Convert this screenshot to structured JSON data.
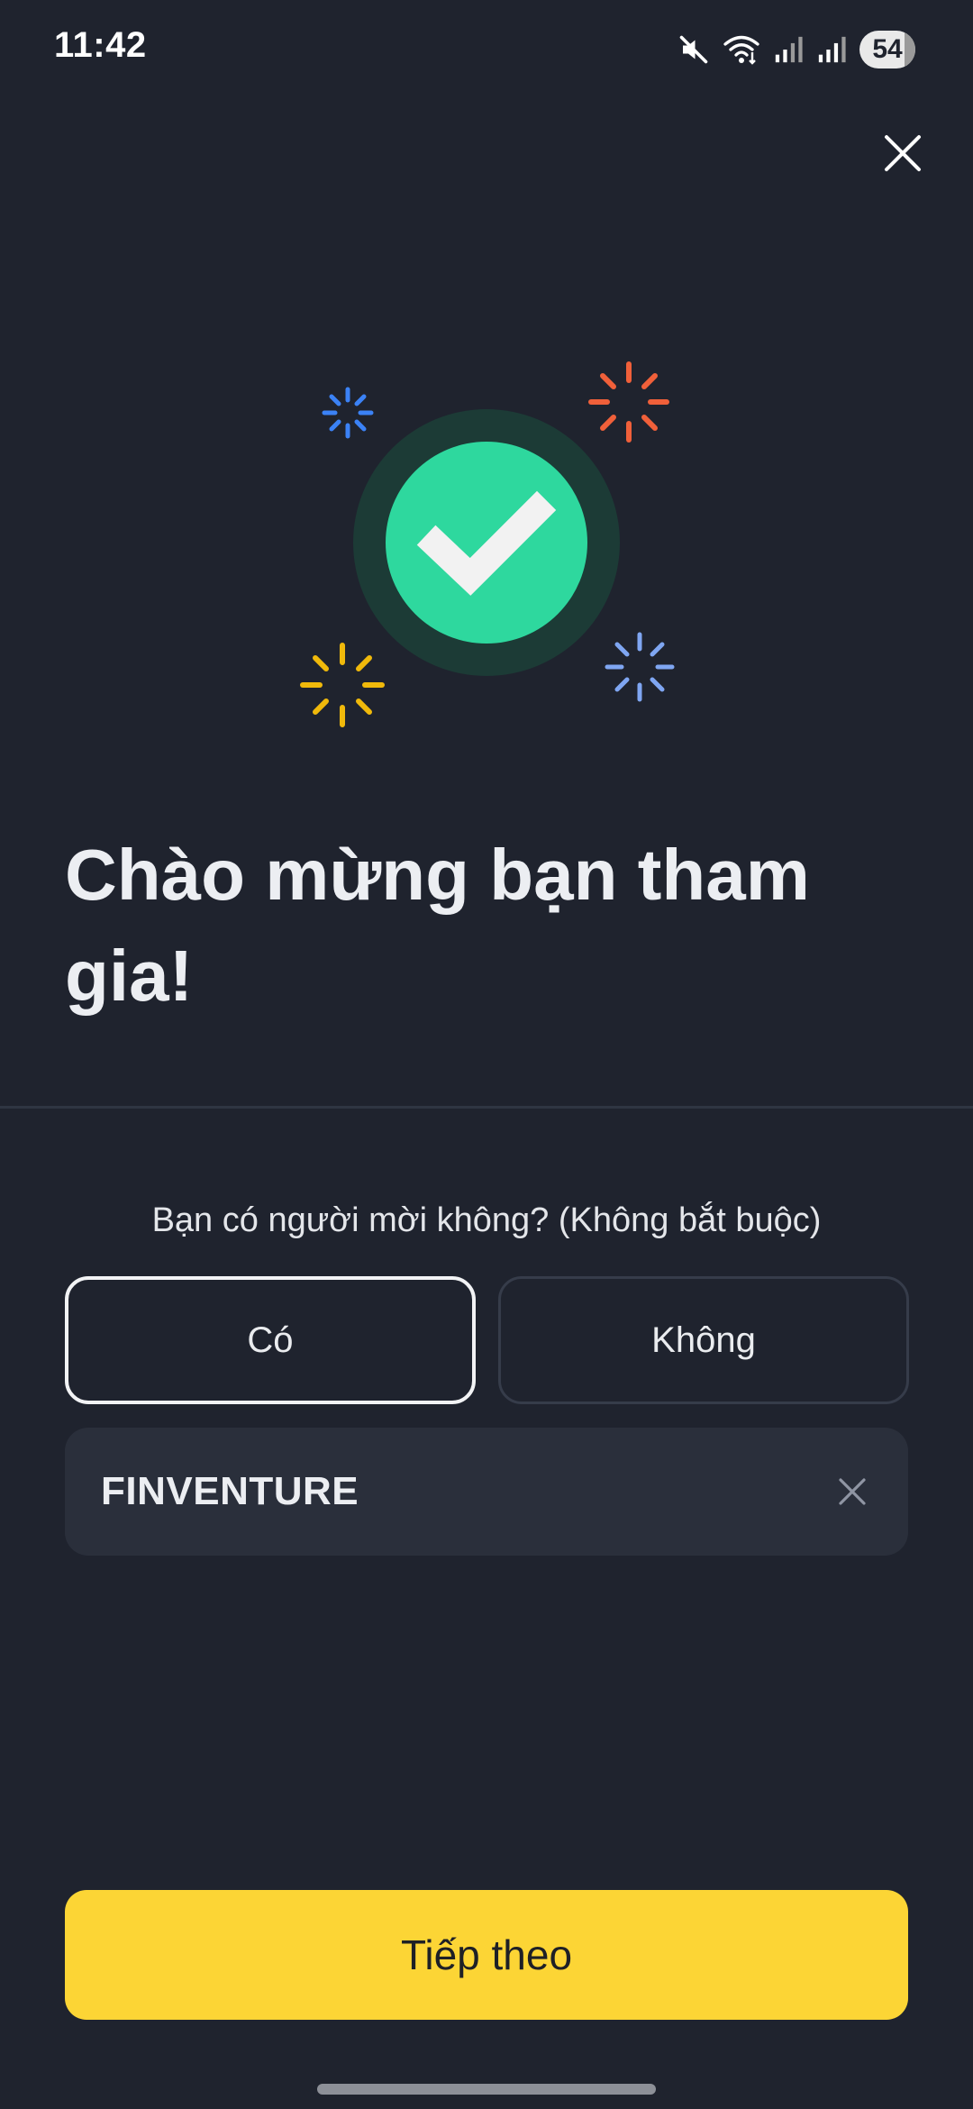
{
  "status_bar": {
    "time": "11:42",
    "battery": "54",
    "icons": [
      "mute-icon",
      "wifi-icon",
      "signal-icon",
      "signal-icon"
    ]
  },
  "close_icon": "close-icon",
  "hero_icon": "check-icon",
  "title": "Chào mừng bạn tham gia!",
  "referral": {
    "question": "Bạn có người mời không? (Không bắt buộc)",
    "options": [
      "Có",
      "Không"
    ],
    "selected": "Có",
    "code_value": "FINVENTURE",
    "clear_icon": "clear-icon"
  },
  "next_button": "Tiếp theo",
  "colors": {
    "background": "#1f232e",
    "accent_yellow": "#fcd535",
    "success_green": "#2ed89e",
    "spark_blue": "#3b82f6",
    "spark_orange": "#f0603a",
    "spark_yellow": "#f0b90b",
    "spark_lightblue": "#7fa6f2"
  }
}
